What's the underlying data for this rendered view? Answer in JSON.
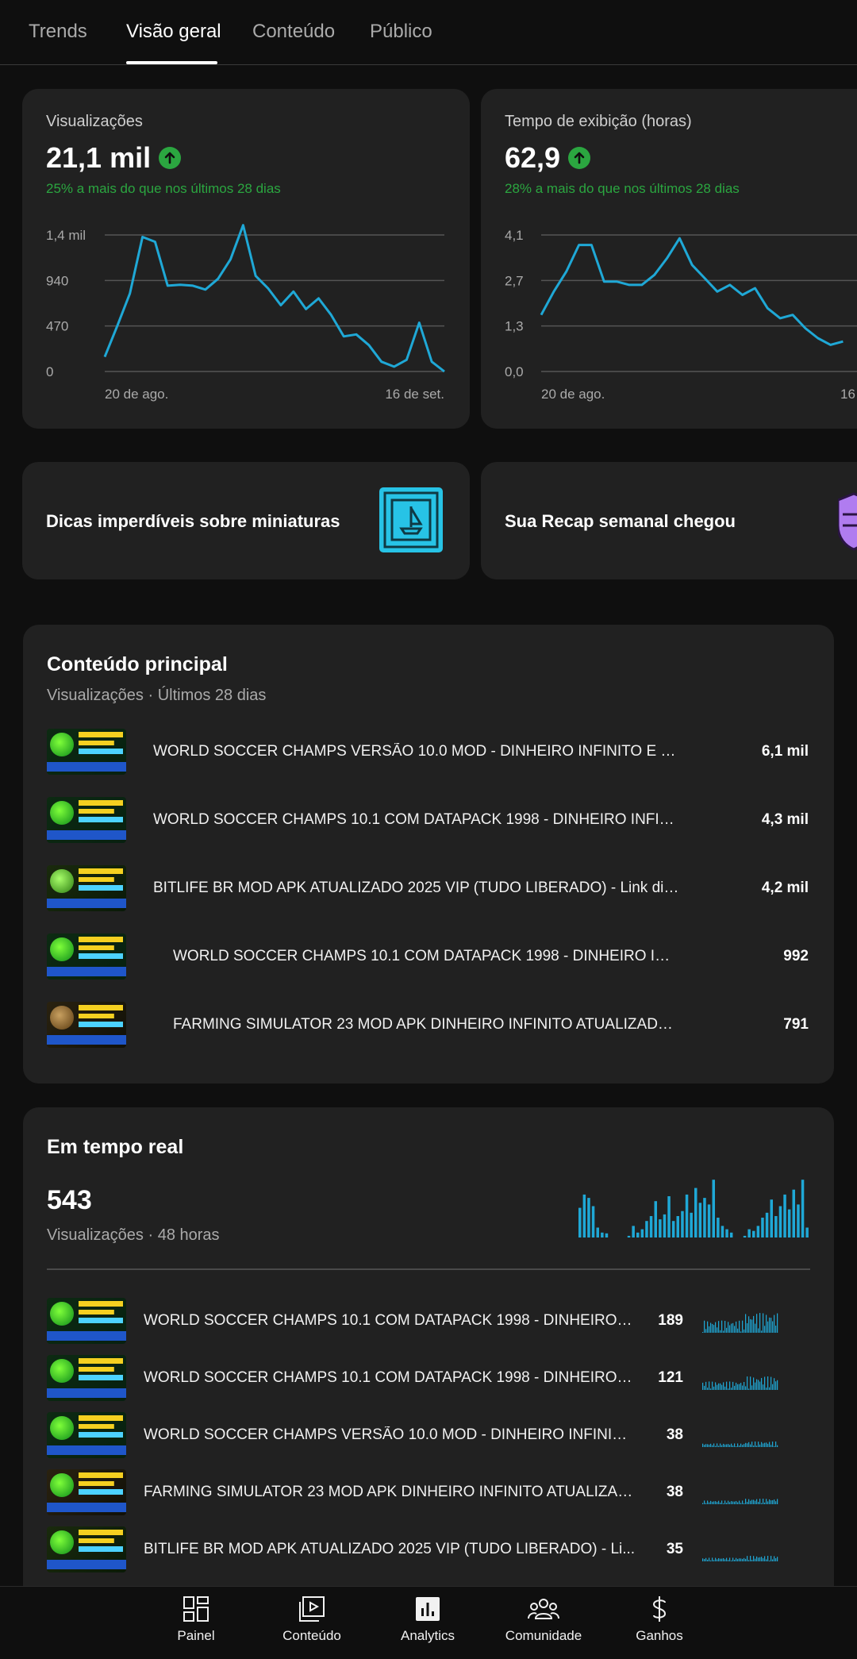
{
  "tabs": [
    {
      "label": "Trends",
      "active": false
    },
    {
      "label": "Visão geral",
      "active": true
    },
    {
      "label": "Conteúdo",
      "active": false
    },
    {
      "label": "Público",
      "active": false
    }
  ],
  "metrics": [
    {
      "title": "Visualizações",
      "value": "21,1 mil",
      "trend_icon": "arrow-up-icon",
      "comparison": "25% a mais do que nos últimos 28 dias",
      "y_ticks": [
        "1,4 mil",
        "940",
        "470",
        "0"
      ],
      "x_labels": [
        "20 de ago.",
        "16 de set."
      ],
      "color": "#1fa8d6"
    },
    {
      "title": "Tempo de exibição (horas)",
      "value": "62,9",
      "trend_icon": "arrow-up-icon",
      "comparison": "28% a mais do que nos últimos 28 dias",
      "y_ticks": [
        "4,1",
        "2,7",
        "1,3",
        "0,0"
      ],
      "x_labels": [
        "20 de ago.",
        "16"
      ],
      "color": "#1fa8d6"
    }
  ],
  "chart_data": [
    {
      "type": "line",
      "title": "Visualizações",
      "x": [
        "20 de ago.",
        "",
        "",
        "",
        "",
        "",
        "",
        "",
        "",
        "",
        "",
        "",
        "",
        "",
        "",
        "",
        "",
        "",
        "",
        "",
        "",
        "",
        "",
        "",
        "",
        "",
        "",
        "16 de set."
      ],
      "series": [
        {
          "values": [
            150,
            470,
            800,
            1380,
            1330,
            880,
            890,
            880,
            840,
            950,
            1150,
            1500,
            980,
            850,
            680,
            820,
            640,
            750,
            580,
            360,
            380,
            270,
            100,
            50,
            120,
            500,
            100,
            0
          ]
        }
      ],
      "ylim": [
        0,
        1400
      ],
      "y_ticks": [
        "0",
        "470",
        "940",
        "1,4 mil"
      ],
      "grid": true
    },
    {
      "type": "line",
      "title": "Tempo de exibição (horas)",
      "x": [
        "20 de ago.",
        "",
        "",
        "",
        "",
        "",
        "",
        "",
        "",
        "",
        "",
        "",
        "",
        "",
        "",
        "",
        "",
        "",
        "",
        "",
        "",
        "",
        "",
        "",
        "",
        "",
        "",
        "16"
      ],
      "series": [
        {
          "values": [
            1.7,
            2.4,
            3.0,
            3.8,
            3.8,
            2.7,
            2.7,
            2.6,
            2.6,
            2.9,
            3.4,
            4.0,
            3.2,
            2.8,
            2.4,
            2.6,
            2.3,
            2.5,
            1.9,
            1.6,
            1.7,
            1.3,
            1.0,
            0.8,
            0.9
          ]
        }
      ],
      "ylim": [
        0,
        4.1
      ],
      "y_ticks": [
        "0,0",
        "1,3",
        "2,7",
        "4,1"
      ],
      "grid": true
    },
    {
      "type": "bar",
      "title": "Em tempo real",
      "values": [
        36,
        52,
        48,
        38,
        12,
        6,
        5,
        0,
        0,
        0,
        0,
        2,
        14,
        6,
        10,
        20,
        26,
        44,
        22,
        28,
        50,
        20,
        26,
        32,
        52,
        30,
        60,
        42,
        48,
        40,
        70,
        24,
        14,
        10,
        6,
        0,
        0,
        2,
        10,
        8,
        14,
        24,
        30,
        46,
        26,
        38,
        52,
        34,
        58,
        40,
        70,
        12
      ],
      "ylim": [
        0,
        75
      ],
      "grid": false
    }
  ],
  "tips": [
    {
      "label": "Dicas imperdíveis sobre miniaturas",
      "icon": "thumbnail-tips-icon"
    },
    {
      "label": "Sua Recap semanal chegou",
      "icon": "recap-shield-icon"
    }
  ],
  "top_content": {
    "title": "Conteúdo principal",
    "subtitle": "Visualizações · Últimos 28 dias",
    "items": [
      {
        "title": "WORLD SOCCER CHAMPS  VERSÃO 10.0 MOD - DINHEIRO INFINITO E PU...",
        "value": "6,1 mil"
      },
      {
        "title": "WORLD SOCCER CHAMPS 10.1 COM DATAPACK 1998 - DINHEIRO INFINI...",
        "value": "4,3 mil"
      },
      {
        "title": "BITLIFE BR MOD APK ATUALIZADO 2025 VIP (TUDO LIBERADO) - Link dir...",
        "value": "4,2 mil"
      },
      {
        "title": "WORLD SOCCER CHAMPS 10.1 COM DATAPACK 1998 - DINHEIRO INFI...",
        "value": "992"
      },
      {
        "title": "FARMING SIMULATOR 23 MOD APK DINHEIRO INFINITO ATUALIZADO...",
        "value": "791"
      }
    ]
  },
  "realtime": {
    "title": "Em tempo real",
    "value": "543",
    "subtitle": "Visualizações · 48 horas",
    "items": [
      {
        "title": "WORLD SOCCER CHAMPS 10.1 COM DATAPACK 1998 - DINHEIRO I...",
        "value": "189"
      },
      {
        "title": "WORLD SOCCER CHAMPS 10.1 COM DATAPACK 1998 - DINHEIRO I...",
        "value": "121"
      },
      {
        "title": "WORLD SOCCER CHAMPS  VERSÃO 10.0 MOD - DINHEIRO INFINITO...",
        "value": "38"
      },
      {
        "title": "FARMING SIMULATOR 23 MOD APK DINHEIRO INFINITO ATUALIZAD...",
        "value": "38"
      },
      {
        "title": "BITLIFE BR MOD APK ATUALIZADO 2025 VIP (TUDO LIBERADO) - Li...",
        "value": "35"
      }
    ]
  },
  "bottom_nav": [
    {
      "label": "Painel",
      "icon": "dashboard-icon"
    },
    {
      "label": "Conteúdo",
      "icon": "content-icon"
    },
    {
      "label": "Analytics",
      "icon": "analytics-icon",
      "active": true
    },
    {
      "label": "Comunidade",
      "icon": "community-icon"
    },
    {
      "label": "Ganhos",
      "icon": "earnings-icon"
    }
  ],
  "colors": {
    "background": "#0f0f0f",
    "card": "#212121",
    "accent_line": "#1fa8d6",
    "positive": "#2ba640",
    "muted_text": "#aaaaaa"
  }
}
